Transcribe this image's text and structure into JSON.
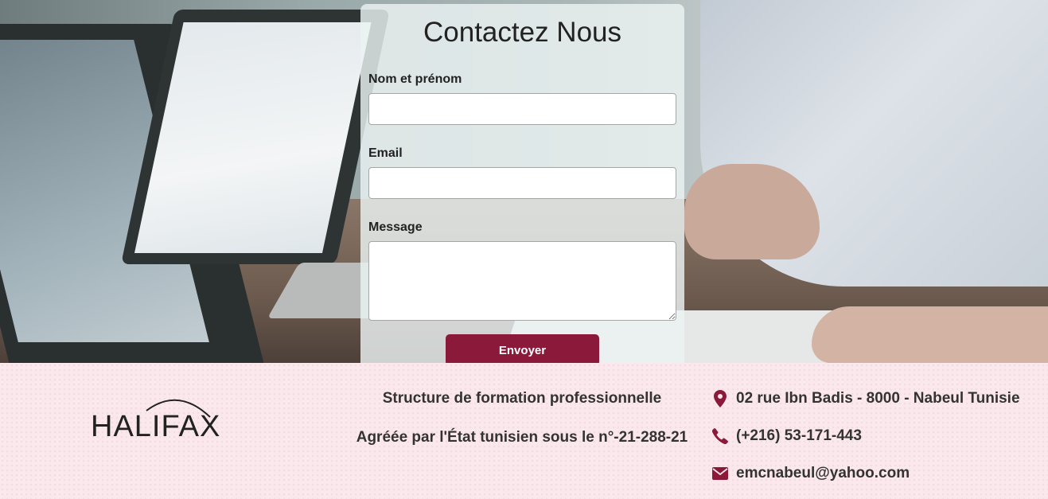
{
  "contact_form": {
    "title": "Contactez Nous",
    "name_label": "Nom et prénom",
    "email_label": "Email",
    "message_label": "Message",
    "submit_label": "Envoyer"
  },
  "footer": {
    "logo_text": "HALIFAX",
    "tagline": "Structure de formation professionnelle",
    "accreditation": "Agréée par l'État tunisien sous le n°-21-288-21",
    "address": "02 rue Ibn Badis - 8000 - Nabeul Tunisie",
    "phone": "(+216) 53-171-443",
    "email": "emcnabeul@yahoo.com"
  },
  "icons": {
    "address": "map-marker-icon",
    "phone": "phone-icon",
    "email": "envelope-icon"
  },
  "colors": {
    "accent": "#8b1a3a",
    "footer_bg": "#fbe8ec"
  }
}
